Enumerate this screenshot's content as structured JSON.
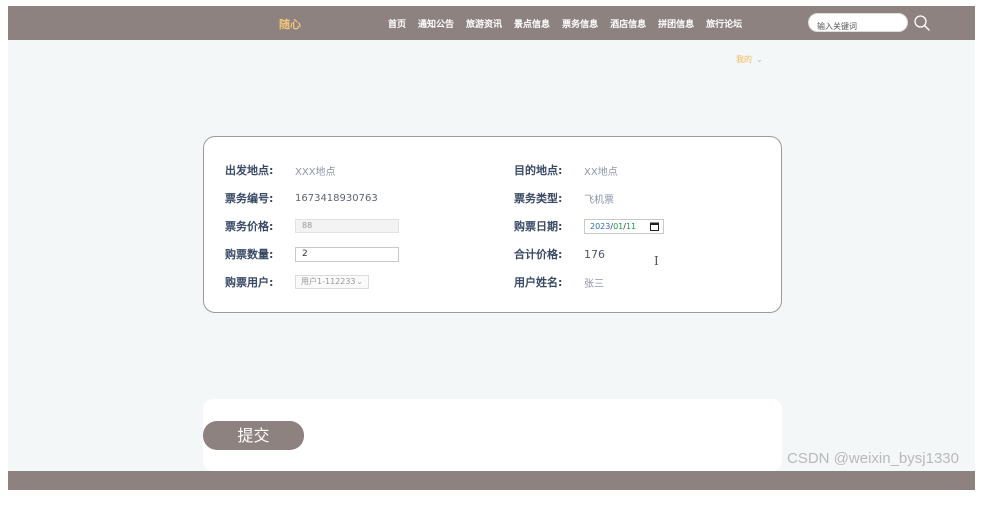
{
  "header": {
    "brand": "随心",
    "nav": [
      "首页",
      "通知公告",
      "旅游资讯",
      "景点信息",
      "票务信息",
      "酒店信息",
      "拼团信息",
      "旅行论坛"
    ],
    "search_placeholder": "输入关键词"
  },
  "user_menu": {
    "label": "我的",
    "chevron": "⌄"
  },
  "form": {
    "departure_label": "出发地点:",
    "departure_value": "XXX地点",
    "destination_label": "目的地点:",
    "destination_value": "XX地点",
    "ticket_no_label": "票务编号:",
    "ticket_no_value": "1673418930763",
    "ticket_type_label": "票务类型:",
    "ticket_type_value": "飞机票",
    "price_label": "票务价格:",
    "price_value": "88",
    "date_label": "购票日期:",
    "date_year": "2023",
    "date_month": "01",
    "date_day": "11",
    "qty_label": "购票数量:",
    "qty_value": "2",
    "total_label": "合计价格:",
    "total_value": "176",
    "buyer_label": "购票用户:",
    "buyer_value": "用户1-112233",
    "username_label": "用户姓名:",
    "username_value": "张三"
  },
  "submit_label": "提交",
  "watermark": "CSDN @weixin_bysj1330",
  "colors": {
    "header": "#8d8280",
    "brand": "#f2c47a",
    "label": "#3a4a66"
  }
}
